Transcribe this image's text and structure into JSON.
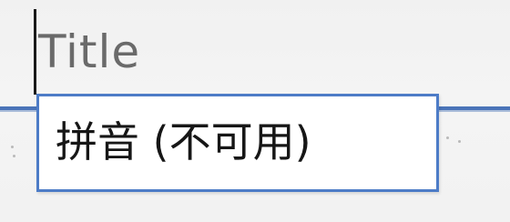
{
  "title_field": {
    "text": "Title"
  },
  "ime_popup": {
    "label": "拼音 (不可用)"
  },
  "colors": {
    "accent": "#4d7cc7",
    "text_dim": "#6a6a6a",
    "text": "#161616"
  }
}
